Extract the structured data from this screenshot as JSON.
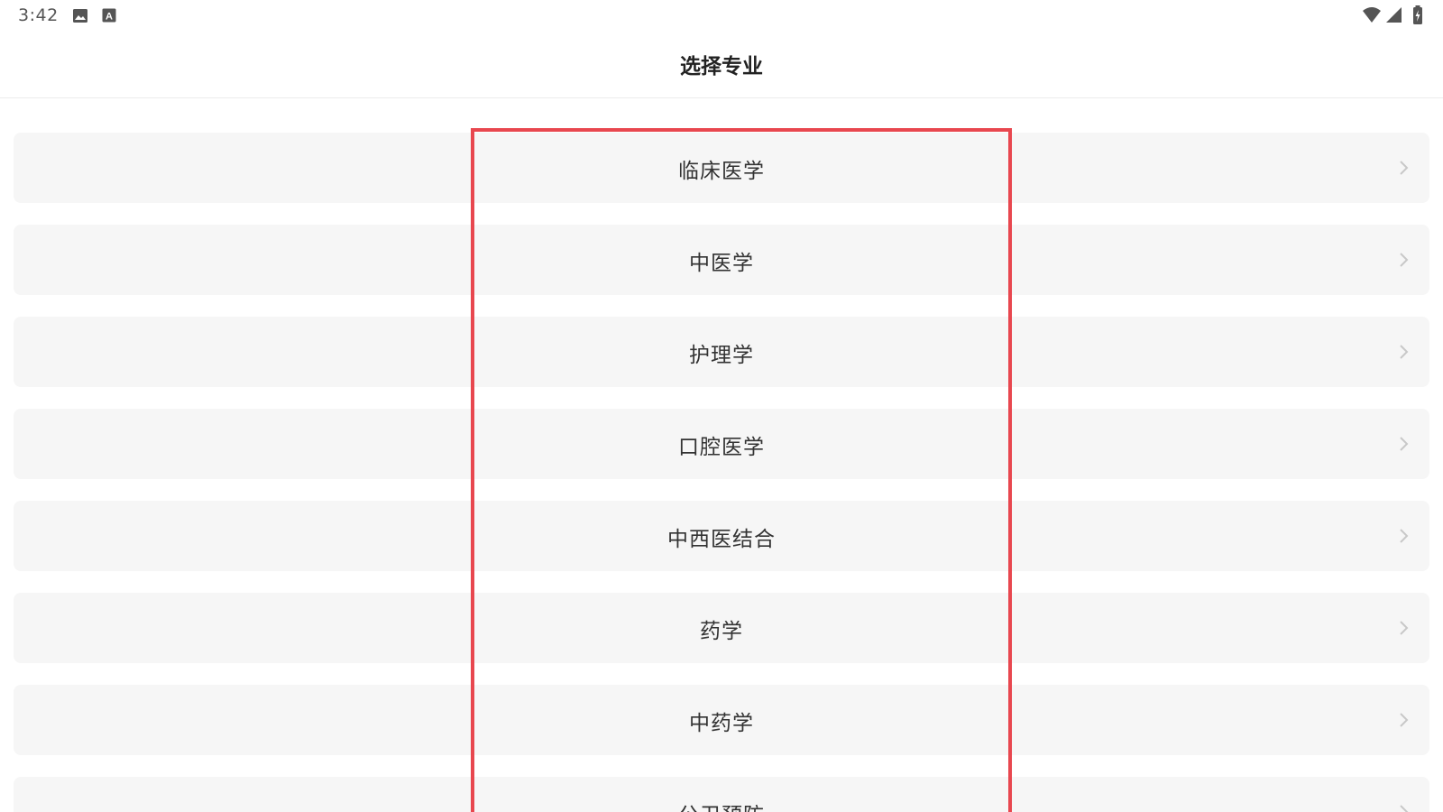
{
  "status_bar": {
    "time": "3:42",
    "left_icons": [
      "image-icon",
      "keyboard-a-icon"
    ],
    "right_icons": [
      "wifi-icon",
      "cell-signal-icon",
      "battery-charging-icon"
    ]
  },
  "header": {
    "title": "选择专业"
  },
  "majors": [
    {
      "label": "临床医学",
      "icon": "chevron-right-icon"
    },
    {
      "label": "中医学",
      "icon": "chevron-right-icon"
    },
    {
      "label": "护理学",
      "icon": "chevron-right-icon"
    },
    {
      "label": "口腔医学",
      "icon": "chevron-right-icon"
    },
    {
      "label": "中西医结合",
      "icon": "chevron-right-icon"
    },
    {
      "label": "药学",
      "icon": "chevron-right-icon"
    },
    {
      "label": "中药学",
      "icon": "chevron-right-icon"
    },
    {
      "label": "公卫预防",
      "icon": "chevron-right-icon"
    }
  ],
  "colors": {
    "row_background": "#f6f6f6",
    "highlight_border": "#e8474f",
    "title_text": "#222222",
    "chevron": "#c8c8c8"
  }
}
